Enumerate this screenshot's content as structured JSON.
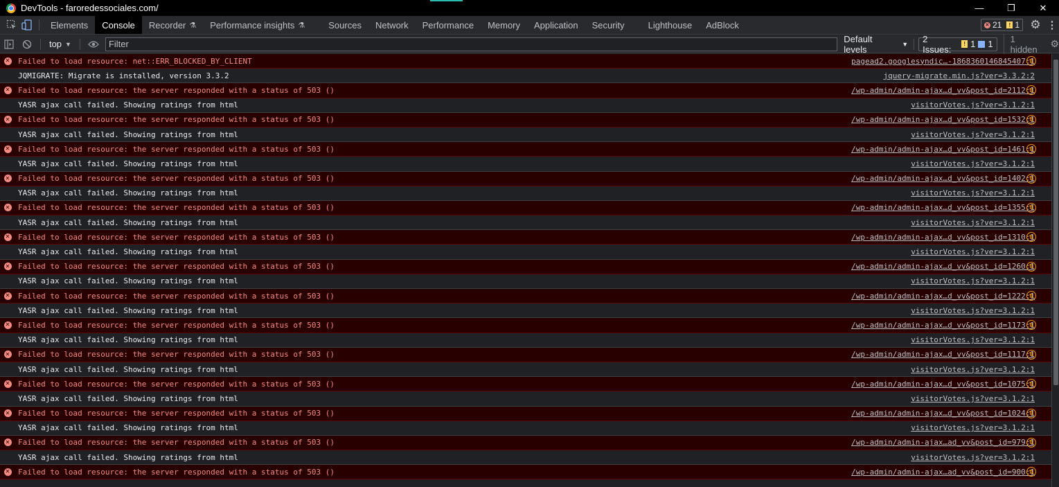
{
  "window": {
    "title": "DevTools - faroredessociales.com/",
    "controls": [
      "minimize",
      "maximize",
      "close"
    ]
  },
  "tabs": [
    {
      "label": "Elements",
      "active": false,
      "experimental": false
    },
    {
      "label": "Console",
      "active": true,
      "experimental": false
    },
    {
      "label": "Recorder",
      "active": false,
      "experimental": true
    },
    {
      "label": "Performance insights",
      "active": false,
      "experimental": true
    },
    {
      "label": "Sources",
      "active": false,
      "experimental": false
    },
    {
      "label": "Network",
      "active": false,
      "experimental": false
    },
    {
      "label": "Performance",
      "active": false,
      "experimental": false
    },
    {
      "label": "Memory",
      "active": false,
      "experimental": false
    },
    {
      "label": "Application",
      "active": false,
      "experimental": false
    },
    {
      "label": "Security",
      "active": false,
      "experimental": false
    },
    {
      "label": "Lighthouse",
      "active": false,
      "experimental": false
    },
    {
      "label": "AdBlock",
      "active": false,
      "experimental": false
    }
  ],
  "counts": {
    "errors": "21",
    "warnings": "1"
  },
  "toolbar": {
    "context": "top",
    "filter_placeholder": "Filter",
    "levels": "Default levels",
    "issues_label": "2 Issues:",
    "issues_warn": "1",
    "issues_info": "1",
    "hidden": "1 hidden"
  },
  "messages": [
    {
      "type": "error",
      "text": "Failed to load resource: net::ERR_BLOCKED_BY_CLIENT",
      "source": "pagead2.googlesyndic…-1868360146845407:1",
      "net": true
    },
    {
      "type": "log",
      "text": "JQMIGRATE: Migrate is installed, version 3.3.2",
      "source": "jquery-migrate.min.js?ver=3.3.2:2",
      "net": false
    },
    {
      "type": "error",
      "text": "Failed to load resource: the server responded with a status of 503 ()",
      "source": "/wp-admin/admin-ajax…d_vv&post_id=2112:1",
      "net": true
    },
    {
      "type": "log",
      "text": "YASR ajax call failed. Showing ratings from html",
      "source": "visitorVotes.js?ver=3.1.2:1",
      "net": false
    },
    {
      "type": "error",
      "text": "Failed to load resource: the server responded with a status of 503 ()",
      "source": "/wp-admin/admin-ajax…d_vv&post_id=1532:1",
      "net": true
    },
    {
      "type": "log",
      "text": "YASR ajax call failed. Showing ratings from html",
      "source": "visitorVotes.js?ver=3.1.2:1",
      "net": false
    },
    {
      "type": "error",
      "text": "Failed to load resource: the server responded with a status of 503 ()",
      "source": "/wp-admin/admin-ajax…d_vv&post_id=1461:1",
      "net": true
    },
    {
      "type": "log",
      "text": "YASR ajax call failed. Showing ratings from html",
      "source": "visitorVotes.js?ver=3.1.2:1",
      "net": false
    },
    {
      "type": "error",
      "text": "Failed to load resource: the server responded with a status of 503 ()",
      "source": "/wp-admin/admin-ajax…d_vv&post_id=1402:1",
      "net": true
    },
    {
      "type": "log",
      "text": "YASR ajax call failed. Showing ratings from html",
      "source": "visitorVotes.js?ver=3.1.2:1",
      "net": false
    },
    {
      "type": "error",
      "text": "Failed to load resource: the server responded with a status of 503 ()",
      "source": "/wp-admin/admin-ajax…d_vv&post_id=1355:1",
      "net": true
    },
    {
      "type": "log",
      "text": "YASR ajax call failed. Showing ratings from html",
      "source": "visitorVotes.js?ver=3.1.2:1",
      "net": false
    },
    {
      "type": "error",
      "text": "Failed to load resource: the server responded with a status of 503 ()",
      "source": "/wp-admin/admin-ajax…d_vv&post_id=1310:1",
      "net": true
    },
    {
      "type": "log",
      "text": "YASR ajax call failed. Showing ratings from html",
      "source": "visitorVotes.js?ver=3.1.2:1",
      "net": false
    },
    {
      "type": "error",
      "text": "Failed to load resource: the server responded with a status of 503 ()",
      "source": "/wp-admin/admin-ajax…d_vv&post_id=1260:1",
      "net": true
    },
    {
      "type": "log",
      "text": "YASR ajax call failed. Showing ratings from html",
      "source": "visitorVotes.js?ver=3.1.2:1",
      "net": false
    },
    {
      "type": "error",
      "text": "Failed to load resource: the server responded with a status of 503 ()",
      "source": "/wp-admin/admin-ajax…d_vv&post_id=1222:1",
      "net": true
    },
    {
      "type": "log",
      "text": "YASR ajax call failed. Showing ratings from html",
      "source": "visitorVotes.js?ver=3.1.2:1",
      "net": false
    },
    {
      "type": "error",
      "text": "Failed to load resource: the server responded with a status of 503 ()",
      "source": "/wp-admin/admin-ajax…d_vv&post_id=1173:1",
      "net": true
    },
    {
      "type": "log",
      "text": "YASR ajax call failed. Showing ratings from html",
      "source": "visitorVotes.js?ver=3.1.2:1",
      "net": false
    },
    {
      "type": "error",
      "text": "Failed to load resource: the server responded with a status of 503 ()",
      "source": "/wp-admin/admin-ajax…d_vv&post_id=1117:1",
      "net": true
    },
    {
      "type": "log",
      "text": "YASR ajax call failed. Showing ratings from html",
      "source": "visitorVotes.js?ver=3.1.2:1",
      "net": false
    },
    {
      "type": "error",
      "text": "Failed to load resource: the server responded with a status of 503 ()",
      "source": "/wp-admin/admin-ajax…d_vv&post_id=1075:1",
      "net": true
    },
    {
      "type": "log",
      "text": "YASR ajax call failed. Showing ratings from html",
      "source": "visitorVotes.js?ver=3.1.2:1",
      "net": false
    },
    {
      "type": "error",
      "text": "Failed to load resource: the server responded with a status of 503 ()",
      "source": "/wp-admin/admin-ajax…d_vv&post_id=1024:1",
      "net": true
    },
    {
      "type": "log",
      "text": "YASR ajax call failed. Showing ratings from html",
      "source": "visitorVotes.js?ver=3.1.2:1",
      "net": false
    },
    {
      "type": "error",
      "text": "Failed to load resource: the server responded with a status of 503 ()",
      "source": "/wp-admin/admin-ajax…ad_vv&post_id=979:1",
      "net": true
    },
    {
      "type": "log",
      "text": "YASR ajax call failed. Showing ratings from html",
      "source": "visitorVotes.js?ver=3.1.2:1",
      "net": false
    },
    {
      "type": "error",
      "text": "Failed to load resource: the server responded with a status of 503 ()",
      "source": "/wp-admin/admin-ajax…ad_vv&post_id=900:1",
      "net": true
    }
  ]
}
